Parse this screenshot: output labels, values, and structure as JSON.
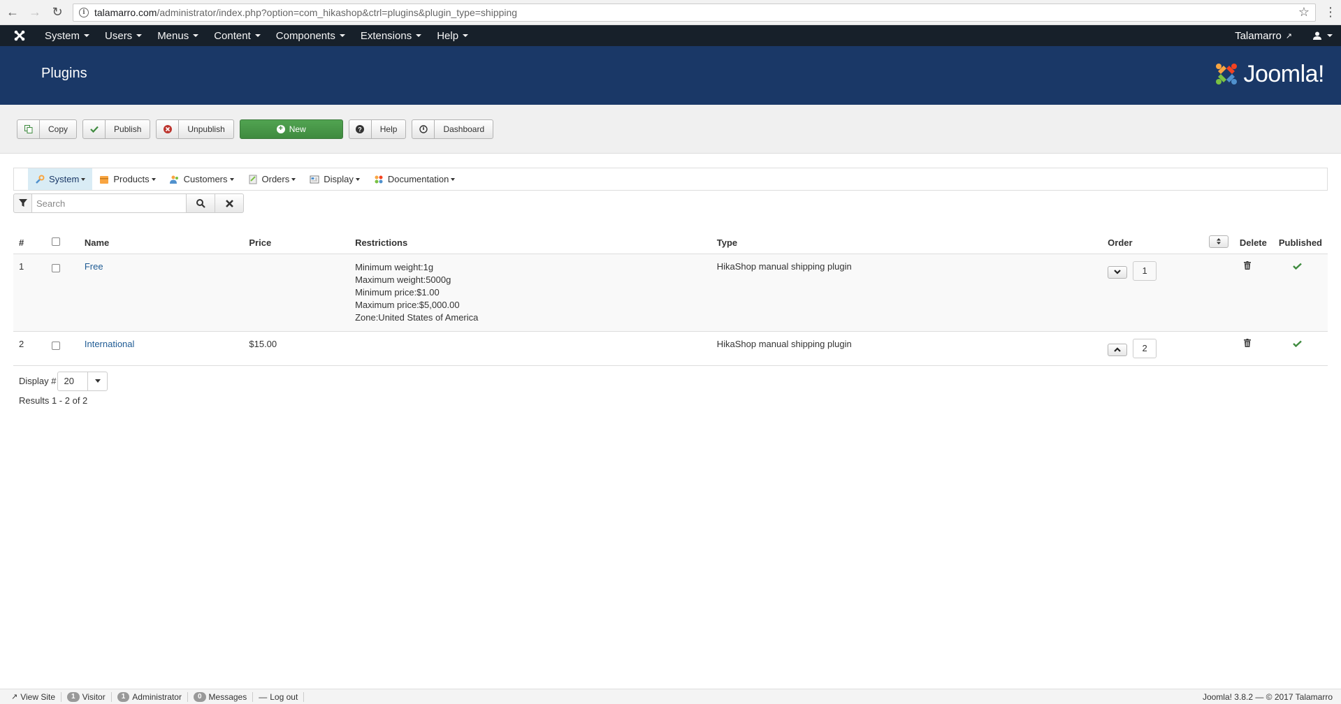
{
  "browser": {
    "url_domain": "talamarro.com",
    "url_path": "/administrator/index.php?option=com_hikashop&ctrl=plugins&plugin_type=shipping"
  },
  "admin_nav": {
    "items": [
      {
        "label": "System"
      },
      {
        "label": "Users"
      },
      {
        "label": "Menus"
      },
      {
        "label": "Content"
      },
      {
        "label": "Components"
      },
      {
        "label": "Extensions"
      },
      {
        "label": "Help"
      }
    ],
    "site_link": "Talamarro"
  },
  "header": {
    "title": "Plugins",
    "logo_text": "Joomla!"
  },
  "toolbar": {
    "copy": "Copy",
    "publish": "Publish",
    "unpublish": "Unpublish",
    "new": "New",
    "help": "Help",
    "dashboard": "Dashboard"
  },
  "hk_menu": {
    "items": [
      {
        "label": "System"
      },
      {
        "label": "Products"
      },
      {
        "label": "Customers"
      },
      {
        "label": "Orders"
      },
      {
        "label": "Display"
      },
      {
        "label": "Documentation"
      }
    ]
  },
  "filter": {
    "placeholder": "Search"
  },
  "table": {
    "headers": {
      "num": "#",
      "name": "Name",
      "price": "Price",
      "restrictions": "Restrictions",
      "type": "Type",
      "order": "Order",
      "delete": "Delete",
      "published": "Published"
    },
    "rows": [
      {
        "num": "1",
        "name": "Free",
        "price": "",
        "restrictions": [
          "Minimum weight:1g",
          "Maximum weight:5000g",
          "Minimum price:$1.00",
          "Maximum price:$5,000.00",
          "Zone:United States of America"
        ],
        "type": "HikaShop manual shipping plugin",
        "order": "1",
        "order_arrow": "down"
      },
      {
        "num": "2",
        "name": "International",
        "price": "$15.00",
        "restrictions": [],
        "type": "HikaShop manual shipping plugin",
        "order": "2",
        "order_arrow": "up"
      }
    ]
  },
  "pagination": {
    "display_label": "Display #",
    "display_value": "20",
    "results": "Results 1 - 2 of 2"
  },
  "status_bar": {
    "view_site": "View Site",
    "visitor_count": "1",
    "visitor_label": "Visitor",
    "admin_count": "1",
    "admin_label": "Administrator",
    "messages_count": "0",
    "messages_label": "Messages",
    "logout": "Log out",
    "version": "Joomla! 3.8.2 — © 2017 Talamarro"
  },
  "colors": {
    "header_bg": "#1a3867",
    "nav_bg": "#17202a",
    "success": "#3f8b3f",
    "link": "#1f5b94",
    "unpublish_red": "#c0392b"
  }
}
